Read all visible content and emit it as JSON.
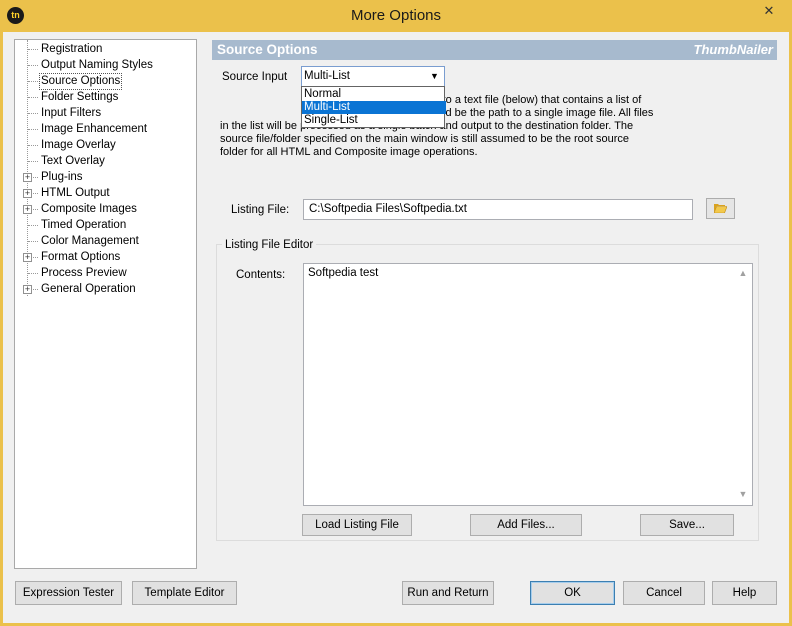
{
  "window": {
    "title": "More Options",
    "close_glyph": "✕",
    "app_icon": "tn"
  },
  "tree": {
    "items": [
      {
        "label": "Registration",
        "expandable": false
      },
      {
        "label": "Output Naming Styles",
        "expandable": false
      },
      {
        "label": "Source Options",
        "expandable": false,
        "selected": true
      },
      {
        "label": "Folder Settings",
        "expandable": false
      },
      {
        "label": "Input Filters",
        "expandable": false
      },
      {
        "label": "Image Enhancement",
        "expandable": false
      },
      {
        "label": "Image Overlay",
        "expandable": false
      },
      {
        "label": "Text Overlay",
        "expandable": false
      },
      {
        "label": "Plug-ins",
        "expandable": true
      },
      {
        "label": "HTML Output",
        "expandable": true
      },
      {
        "label": "Composite Images",
        "expandable": true
      },
      {
        "label": "Timed Operation",
        "expandable": false
      },
      {
        "label": "Color Management",
        "expandable": false
      },
      {
        "label": "Format Options",
        "expandable": true
      },
      {
        "label": "Process Preview",
        "expandable": false
      },
      {
        "label": "General Operation",
        "expandable": true
      }
    ]
  },
  "header": {
    "title": "Source Options",
    "brand": "ThumbNailer",
    "color": "#a7bace"
  },
  "source_input": {
    "label": "Source Input",
    "value": "Multi-List",
    "options": [
      "Normal",
      "Multi-List",
      "Single-List"
    ],
    "selected_index": 1
  },
  "description": {
    "line1": "pecify the path to a text file (below) that contains a list of",
    "line2": "he text file should be the path to a single image file. All files",
    "line3": "in the list will be processed as a single batch and output to the destination folder. The",
    "line4": "source file/folder specified on the main window is still assumed to be the root source",
    "line5": "folder for all HTML and Composite image operations."
  },
  "listing_file": {
    "label": "Listing File:",
    "value": "C:\\Softpedia Files\\Softpedia.txt",
    "browse_icon": "folder-open-icon"
  },
  "editor": {
    "group_label": "Listing File Editor",
    "contents_label": "Contents:",
    "contents": "Softpedia test",
    "load_button": "Load Listing File",
    "add_button": "Add Files...",
    "save_button": "Save..."
  },
  "footer": {
    "expression_tester": "Expression Tester",
    "template_editor": "Template Editor",
    "run_and_return": "Run and Return",
    "ok": "OK",
    "cancel": "Cancel",
    "help": "Help"
  },
  "colors": {
    "frame": "#ebc14b",
    "selection": "#0a74d4"
  }
}
